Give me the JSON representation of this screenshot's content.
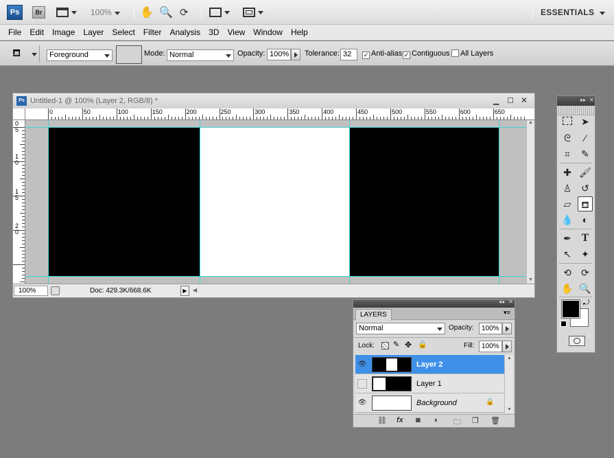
{
  "appbar": {
    "ps_label": "Ps",
    "br_label": "Br",
    "zoom": "100%",
    "workspace": "ESSENTIALS"
  },
  "menu": [
    "File",
    "Edit",
    "Image",
    "Layer",
    "Select",
    "Filter",
    "Analysis",
    "3D",
    "View",
    "Window",
    "Help"
  ],
  "options": {
    "fill_source": "Foreground",
    "mode_label": "Mode:",
    "mode_value": "Normal",
    "opacity_label": "Opacity:",
    "opacity_value": "100%",
    "tolerance_label": "Tolerance:",
    "tolerance_value": "32",
    "antialias_label": "Anti-alias",
    "contiguous_label": "Contiguous",
    "all_layers_label": "All Layers"
  },
  "document": {
    "title": "Untitled-1 @ 100% (Layer 2, RGB/8) *",
    "ruler_top": [
      "0",
      "50",
      "100",
      "150",
      "200",
      "250",
      "300",
      "350",
      "400",
      "450",
      "500",
      "550",
      "600",
      "650"
    ],
    "ruler_left": [
      "0",
      "5",
      "1",
      "0",
      "1",
      "5",
      "2",
      "0"
    ],
    "status_zoom": "100%",
    "status_doc": "Doc: 429.3K/668.6K",
    "colors": {
      "black": "#000000",
      "white": "#ffffff",
      "guide": "#3fd5d5"
    }
  },
  "tools": {
    "icons": [
      "marquee-icon",
      "move-icon",
      "lasso-icon",
      "magic-wand-icon",
      "crop-icon",
      "eyedropper-icon",
      "healing-icon",
      "brush-icon",
      "stamp-icon",
      "history-brush-icon",
      "eraser-icon",
      "paint-bucket-icon",
      "blur-icon",
      "dodge-icon",
      "pen-icon",
      "type-icon",
      "path-select-icon",
      "shape-icon",
      "3d-rotate-icon",
      "3d-orbit-icon",
      "hand-icon",
      "zoom-icon"
    ],
    "type_glyph": "T"
  },
  "layers": {
    "tab": "LAYERS",
    "blend_mode": "Normal",
    "opacity_label": "Opacity:",
    "opacity_value": "100%",
    "lock_label": "Lock:",
    "fill_label": "Fill:",
    "fill_value": "100%",
    "items": [
      {
        "name": "Layer 2",
        "visible": true,
        "selected": true
      },
      {
        "name": "Layer 1",
        "visible": false,
        "selected": false
      },
      {
        "name": "Background",
        "visible": true,
        "selected": false
      }
    ],
    "accent": "#3e90e8"
  }
}
